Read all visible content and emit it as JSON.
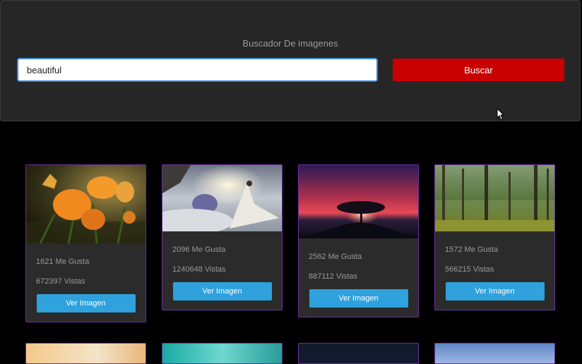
{
  "header": {
    "title": "Buscador De imagenes",
    "search_value": "beautiful",
    "search_button": "Buscar"
  },
  "cards": [
    {
      "likes": "1621 Me Gusta",
      "views": "672397 Vistas",
      "button": "Ver Imagen"
    },
    {
      "likes": "2096 Me Gusta",
      "views": "1240648 Vistas",
      "button": "Ver Imagen"
    },
    {
      "likes": "2562 Me Gusta",
      "views": "887112 Vistas",
      "button": "Ver Imagen"
    },
    {
      "likes": "1572 Me Gusta",
      "views": "566215 Vistas",
      "button": "Ver Imagen"
    }
  ],
  "colors": {
    "accent_button": "#c90000",
    "view_button": "#2fa1dc",
    "card_border": "#6c2f9e"
  }
}
